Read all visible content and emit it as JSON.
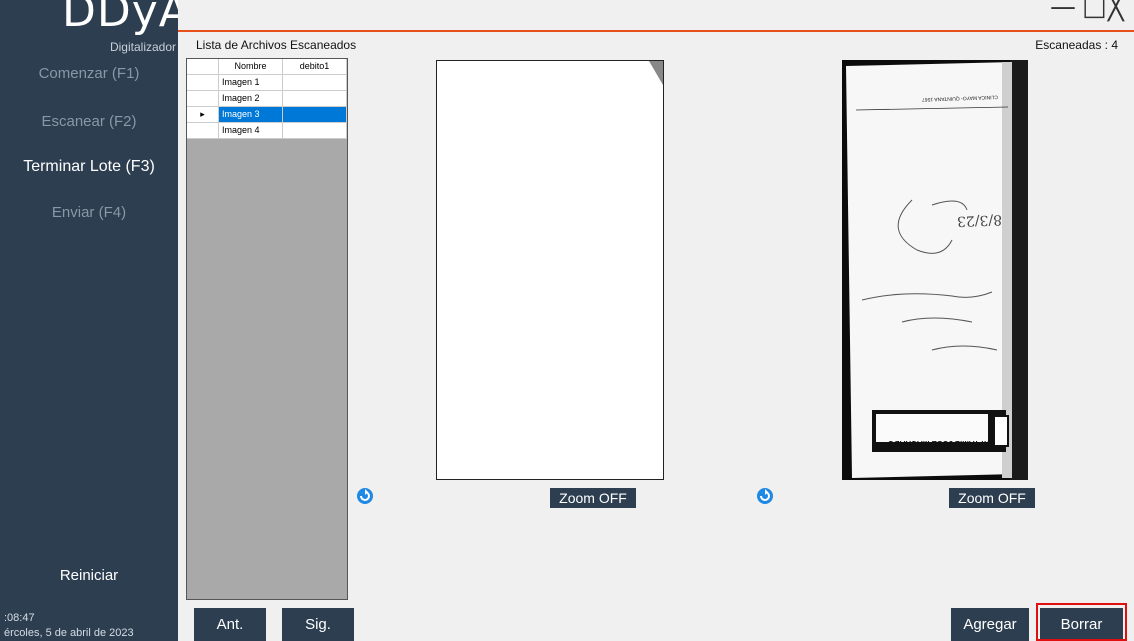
{
  "app": {
    "logo": "DDyA",
    "subtitle": "Digitalizador"
  },
  "sidebar": {
    "items": [
      {
        "label": "Comenzar (F1)",
        "active": false
      },
      {
        "label": "Escanear (F2)",
        "active": false
      },
      {
        "label": "Terminar Lote (F3)",
        "active": true
      },
      {
        "label": "Enviar (F4)",
        "active": false
      }
    ],
    "reset_label": "Reiniciar",
    "clock": ":08:47",
    "date": "ércoles, 5 de abril de 2023"
  },
  "colors": {
    "sidebar_bg": "#2c3e50",
    "accent": "#e8501c",
    "selection": "#0078d7",
    "highlight_border": "#e01010"
  },
  "window_controls": {
    "minimize": "—",
    "maximize": "□",
    "close": "╳"
  },
  "list": {
    "title": "Lista de Archivos Escaneados",
    "columns": [
      "Nombre",
      "debito1"
    ],
    "rows": [
      {
        "name": "Imagen 1",
        "debito": "",
        "selected": false
      },
      {
        "name": "Imagen 2",
        "debito": "",
        "selected": false
      },
      {
        "name": "Imagen 3",
        "debito": "",
        "selected": true
      },
      {
        "name": "Imagen 4",
        "debito": "",
        "selected": false
      }
    ],
    "row_indicator": "▸"
  },
  "scanned_count": "Escaneadas : 4",
  "viewer_left": {
    "zoom_label": "Zoom OFF",
    "rotate_icon": "rotate-icon"
  },
  "viewer_right": {
    "zoom_label": "Zoom OFF",
    "rotate_icon": "rotate-icon",
    "doc_header": "CLINICA MAYO- QUINTANA 1567",
    "doc_stamp": "Dr. YAMIL JOSE MACHADO",
    "doc_handwritten_date": "8/3/23"
  },
  "footer": {
    "prev_label": "Ant.",
    "next_label": "Sig.",
    "add_label": "Agregar",
    "delete_label": "Borrar"
  }
}
